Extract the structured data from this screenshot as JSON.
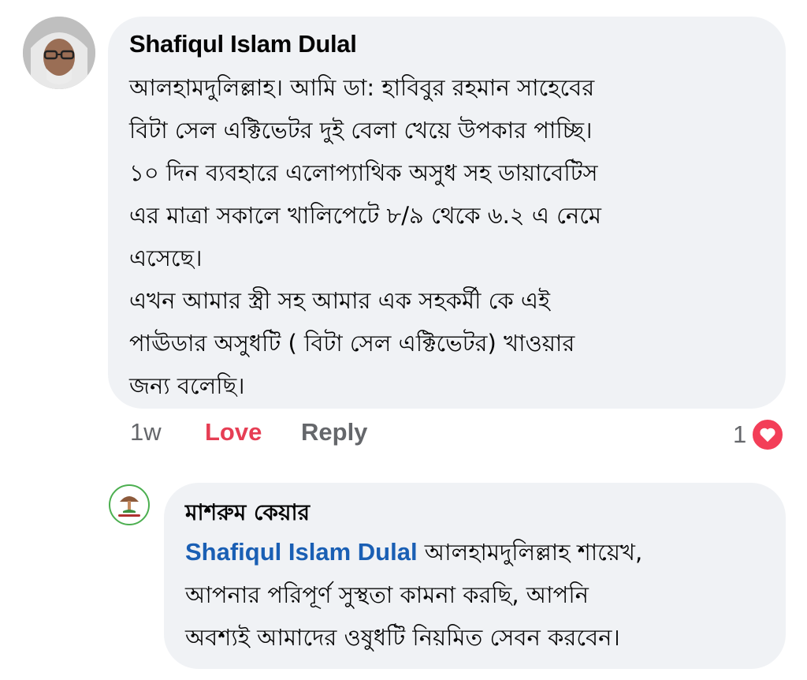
{
  "comment": {
    "author": "Shafiqul Islam Dulal",
    "lines": [
      "আলহামদুলিল্লাহ। আমি ডা: হাবিবুর রহমান সাহেবের",
      "বিটা সেল এক্টিভেটর দুই বেলা খেয়ে উপকার পাচ্ছি।",
      "১০ দিন ব্যবহারে এলোপ্যাথিক অসুধ সহ ডায়াবেটিস",
      "এর মাত্রা সকালে খালিপেটে  ৮/৯ থেকে ৬.২ এ নেমে",
      "এসেছে।",
      "এখন আমার স্ত্রী  সহ আমার এক সহকর্মী কে এই",
      "পাঊডার অসুধটি ( বিটা সেল এক্টিভেটর)  খাওয়ার",
      "জন্য বলেছি।"
    ],
    "time": "1w",
    "love_label": "Love",
    "reply_label": "Reply",
    "reaction_count": "1",
    "reaction_icon": "heart-icon"
  },
  "reply": {
    "author": "মাশরুম কেয়ার",
    "mention": "Shafiqul Islam Dulal",
    "line1_rest": " আলহামদুলিল্লাহ শায়েখ,",
    "line2": "আপনার পরিপূর্ণ সুস্থতা কামনা করছি, আপনি",
    "line3": "অবশ্যই আমাদের ওষুধটি নিয়মিত সেবন করবেন।"
  },
  "colors": {
    "bubble": "#f0f2f5",
    "love": "#e63e54",
    "mention": "#1a5fb4",
    "muted": "#65676b",
    "heart": "#f33e58"
  }
}
